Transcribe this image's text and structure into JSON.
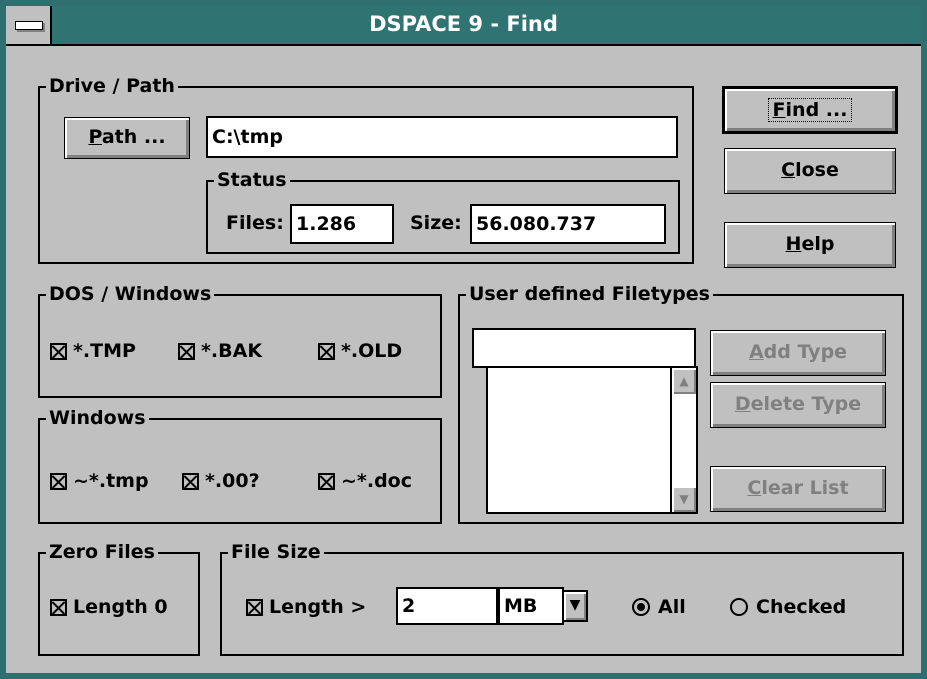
{
  "window": {
    "title": "DSPACE 9 - Find"
  },
  "drive_path": {
    "legend": "Drive / Path",
    "path_button": {
      "prefix": "",
      "accel": "P",
      "rest": "ath ..."
    },
    "path_value": "C:\\tmp",
    "status": {
      "legend": "Status",
      "files_label": "Files:",
      "files_value": "1.286",
      "size_label": "Size:",
      "size_value": "56.080.737"
    }
  },
  "buttons": {
    "find": {
      "accel": "F",
      "rest": "ind ..."
    },
    "close": {
      "accel": "C",
      "rest": "lose"
    },
    "help": {
      "accel": "H",
      "rest": "elp"
    }
  },
  "dos_windows": {
    "legend": "DOS / Windows",
    "items": [
      {
        "label": "*.TMP",
        "checked": true
      },
      {
        "label": "*.BAK",
        "checked": true
      },
      {
        "label": "*.OLD",
        "checked": true
      }
    ]
  },
  "windows": {
    "legend": "Windows",
    "items": [
      {
        "label": "~*.tmp",
        "checked": true
      },
      {
        "label": "*.00?",
        "checked": true
      },
      {
        "label": "~*.doc",
        "checked": true
      }
    ]
  },
  "user_types": {
    "legend": "User defined Filetypes",
    "input_value": "",
    "add_button": {
      "accel": "A",
      "rest": "dd Type"
    },
    "delete_button": {
      "accel": "D",
      "rest": "elete Type"
    },
    "clear_button": {
      "accel": "C",
      "rest": "lear List"
    }
  },
  "zero_files": {
    "legend": "Zero Files",
    "label": "Length 0",
    "checked": true
  },
  "file_size": {
    "legend": "File Size",
    "length_label": "Length >",
    "length_value": "2",
    "unit_value": "MB",
    "radio_all": "All",
    "radio_checked": "Checked",
    "selected": "All"
  }
}
